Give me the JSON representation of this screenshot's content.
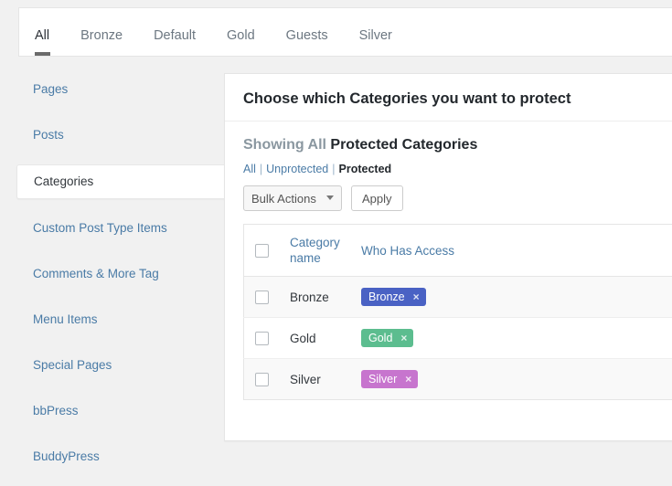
{
  "top_tabs": [
    {
      "label": "All",
      "active": true
    },
    {
      "label": "Bronze",
      "active": false
    },
    {
      "label": "Default",
      "active": false
    },
    {
      "label": "Gold",
      "active": false
    },
    {
      "label": "Guests",
      "active": false
    },
    {
      "label": "Silver",
      "active": false
    }
  ],
  "sidebar": {
    "items": [
      {
        "label": "Pages",
        "active": false
      },
      {
        "label": "Posts",
        "active": false
      },
      {
        "label": "Categories",
        "active": true
      },
      {
        "label": "Custom Post Type Items",
        "active": false
      },
      {
        "label": "Comments & More Tag",
        "active": false
      },
      {
        "label": "Menu Items",
        "active": false
      },
      {
        "label": "Special Pages",
        "active": false
      },
      {
        "label": "bbPress",
        "active": false
      },
      {
        "label": "BuddyPress",
        "active": false
      }
    ]
  },
  "panel": {
    "title": "Choose which Categories you want to protect",
    "showing_prefix": "Showing All",
    "showing_suffix": "Protected Categories",
    "filters": [
      {
        "label": "All",
        "current": false
      },
      {
        "label": "Unprotected",
        "current": false
      },
      {
        "label": "Protected",
        "current": true
      }
    ],
    "filter_separator": "|",
    "bulk_actions_label": "Bulk Actions",
    "bulk_actions_options": [
      "Bulk Actions"
    ],
    "apply_label": "Apply",
    "caret_icon": "chevron-down-icon"
  },
  "table": {
    "headers": {
      "select_all": "select-all-checkbox",
      "category_name": "Category name",
      "who_has_access": "Who Has Access"
    },
    "rows": [
      {
        "name": "Bronze",
        "tags": [
          {
            "label": "Bronze",
            "color": "#4a62c4",
            "remove_icon": "×"
          }
        ]
      },
      {
        "name": "Gold",
        "tags": [
          {
            "label": "Gold",
            "color": "#5cbd8f",
            "remove_icon": "×"
          }
        ]
      },
      {
        "name": "Silver",
        "tags": [
          {
            "label": "Silver",
            "color": "#c775ce",
            "remove_icon": "×"
          }
        ]
      }
    ]
  },
  "colors": {
    "page_background": "#f1f1f1",
    "card_background": "#ffffff",
    "link": "#4a7ba6",
    "heading": "#23282d",
    "muted_heading": "#8a97a0",
    "row_alt": "#f9f9f9",
    "active_tab_underline": "#6b6b6b"
  }
}
